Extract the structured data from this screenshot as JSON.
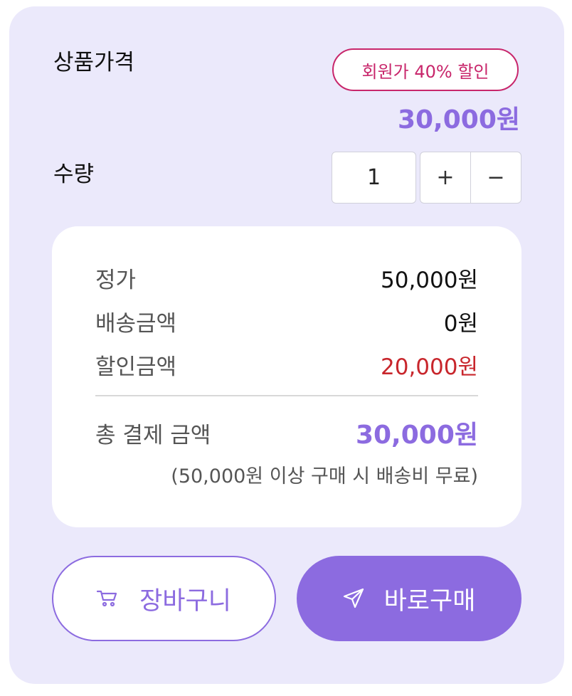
{
  "product": {
    "price_label": "상품가격",
    "badge": "회원가 40% 할인",
    "price": "30,000원"
  },
  "quantity": {
    "label": "수량",
    "value": "1",
    "plus": "+",
    "minus": "−"
  },
  "summary": {
    "rows": [
      {
        "label": "정가",
        "value": "50,000원"
      },
      {
        "label": "배송금액",
        "value": "0원"
      },
      {
        "label": "할인금액",
        "value": "20,000원"
      }
    ],
    "total_label": "총 결제 금액",
    "total_value": "30,000원",
    "note": "(50,000원 이상 구매 시 배송비 무료)"
  },
  "actions": {
    "cart_label": "장바구니",
    "buy_label": "바로구매"
  },
  "colors": {
    "accent": "#8c6be0",
    "badge": "#c8266b",
    "discount": "#c8262c",
    "card_bg": "#ebe9fb"
  },
  "icons": {
    "cart": "cart-icon",
    "buy": "send-icon"
  }
}
